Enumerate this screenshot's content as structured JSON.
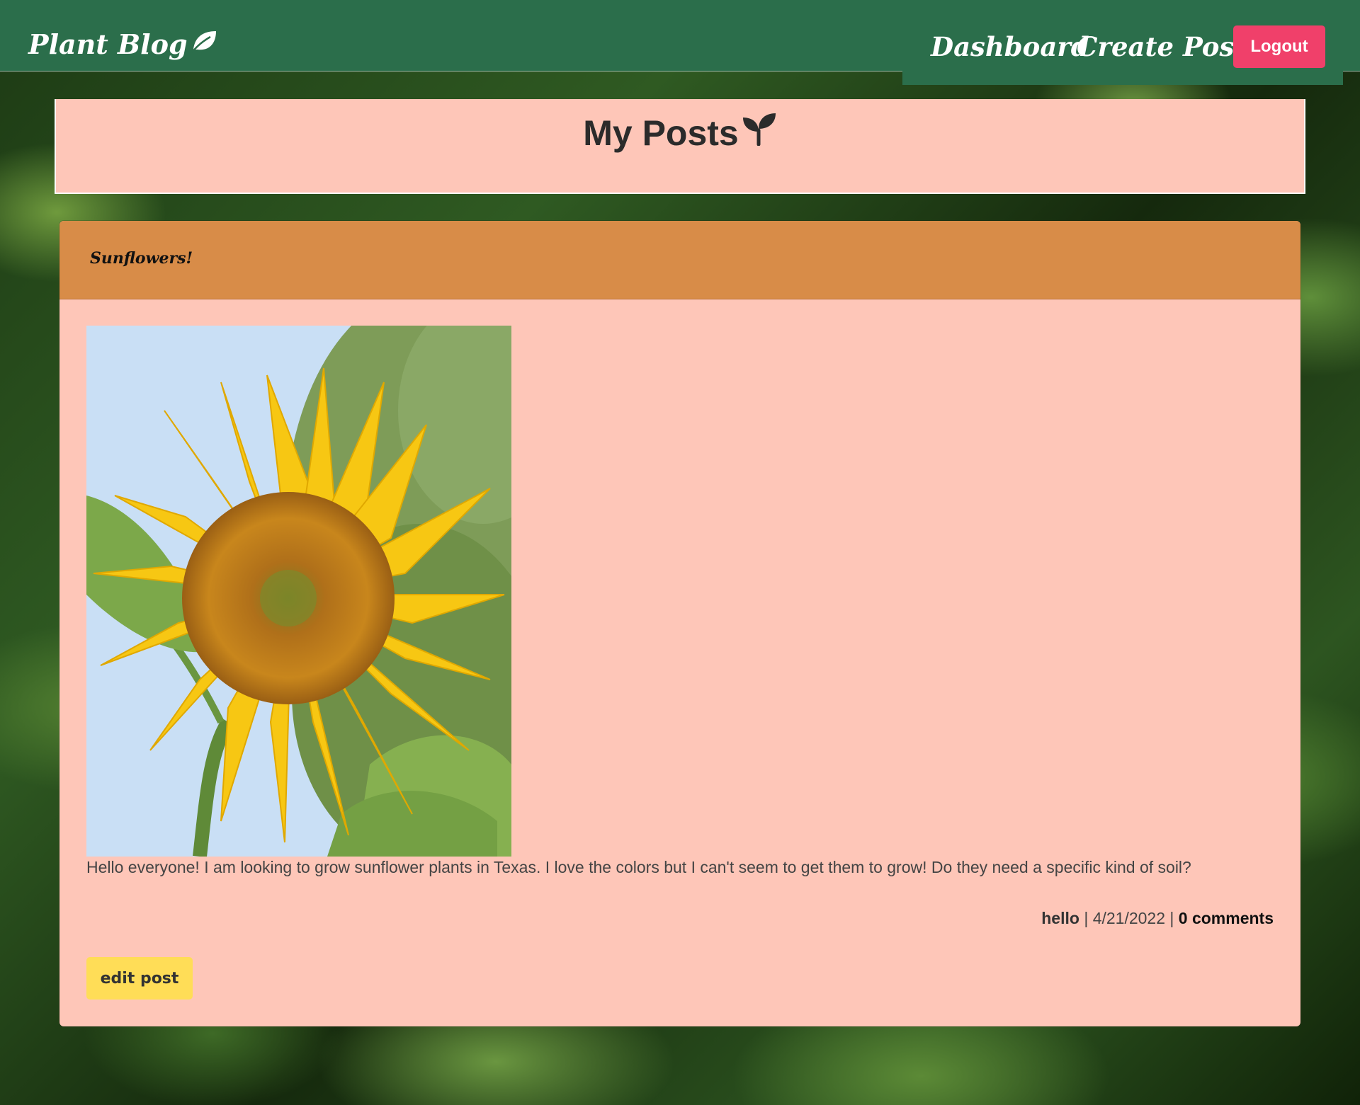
{
  "navbar": {
    "brand": "Plant Blog",
    "brand_icon": "leaf-icon",
    "links": [
      {
        "label": "Dashboard"
      },
      {
        "label": "Create Post"
      }
    ],
    "logout_label": "Logout"
  },
  "page": {
    "title": "My Posts",
    "title_icon": "seedling-icon"
  },
  "post": {
    "title": "Sunflowers!",
    "image_subject": "sunflower",
    "body": "Hello everyone! I am looking to grow sunflower plants in Texas. I love the colors but I can't seem to get them to grow! Do they need a specific kind of soil?",
    "author": "hello",
    "separator": "|",
    "date": "4/21/2022",
    "comments": "0 comments",
    "edit_label": "edit post"
  },
  "colors": {
    "navbar": "#2b6e4b",
    "logout": "#f0406a",
    "header_bg": "#fec6b8",
    "card_header": "#d88c48",
    "edit_button": "#ffdd57"
  }
}
